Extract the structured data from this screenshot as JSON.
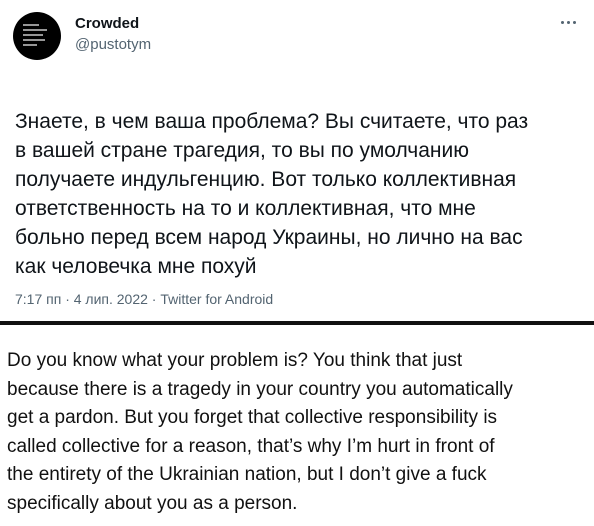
{
  "tweet": {
    "display_name": "Crowded",
    "handle": "@pustotym",
    "more_icon": "more-horizontal-icon",
    "text_lines": [
      "Знаете, в чем ваша проблема? Вы считаете, что раз",
      "в вашей стране трагедия, то вы по умолчанию",
      "получаете индульгенцию. Вот только коллективная",
      "ответственность на то и коллективная, что мне",
      "больно перед всем народ Украины, но лично на вас",
      "как человечка мне похуй"
    ],
    "timestamp": "7:17 пп · 4 лип. 2022 · Twitter for Android"
  },
  "translation": {
    "lines": [
      "Do you know what your problem is? You think that just",
      "because there is a tragedy in your country you automatically",
      "get a pardon. But you forget that collective responsibility is",
      "called collective for a reason, that’s why I’m hurt in front of",
      "the entirety of the Ukrainian nation, but I don’t give a fuck",
      "specifically about you as a person."
    ]
  },
  "colors": {
    "primary_text": "#0f1419",
    "secondary_text": "#536471",
    "separator": "#111111"
  }
}
